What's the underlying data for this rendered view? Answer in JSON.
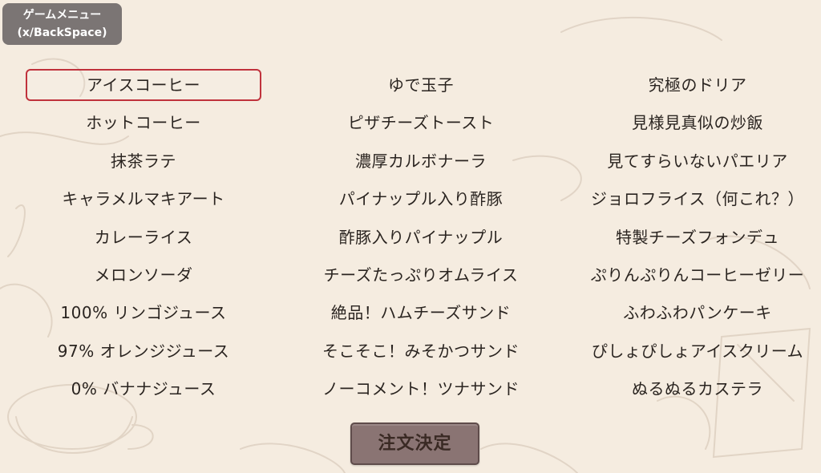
{
  "game_menu": {
    "line1": "ゲームメニュー",
    "line2": "(x/BackSpace)"
  },
  "menu": {
    "columns": [
      {
        "items": [
          "アイスコーヒー",
          "ホットコーヒー",
          "抹茶ラテ",
          "キャラメルマキアート",
          "カレーライス",
          "メロンソーダ",
          "100% リンゴジュース",
          "97% オレンジジュース",
          "0% バナナジュース"
        ]
      },
      {
        "items": [
          "ゆで玉子",
          "ピザチーズトースト",
          "濃厚カルボナーラ",
          "パイナップル入り酢豚",
          "酢豚入りパイナップル",
          "チーズたっぷりオムライス",
          "絶品！ハムチーズサンド",
          "そこそこ！みそかつサンド",
          "ノーコメント！ツナサンド"
        ]
      },
      {
        "items": [
          "究極のドリア",
          "見様見真似の炒飯",
          "見てすらいないパエリア",
          "ジョロフライス（何これ？）",
          "特製チーズフォンデュ",
          "ぷりんぷりんコーヒーゼリー",
          "ふわふわパンケーキ",
          "ぴしょぴしょアイスクリーム",
          "ぬるぬるカステラ"
        ]
      }
    ],
    "selected": "アイスコーヒー"
  },
  "order_button": {
    "label": "注文決定"
  },
  "colors": {
    "background": "#f5ece0",
    "selection_border": "#c0323c",
    "menu_button_bg": "#7b7574",
    "order_button_bg": "#8a7473"
  }
}
